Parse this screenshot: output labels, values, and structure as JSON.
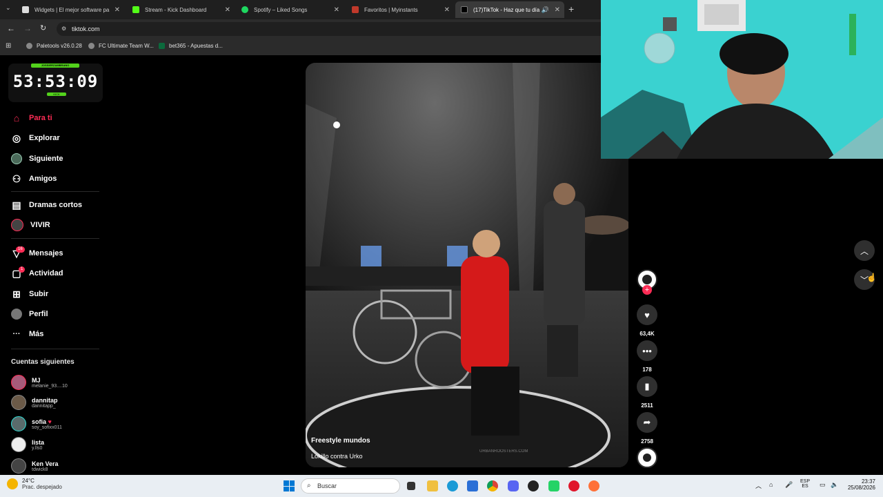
{
  "browser": {
    "tabs": [
      {
        "title": "Widgets | El mejor software pa",
        "color": "#3a3a3a"
      },
      {
        "title": "Stream - Kick Dashboard",
        "color": "#53fc18"
      },
      {
        "title": "Spotify – Liked Songs",
        "color": "#1ed760"
      },
      {
        "title": "Favoritos | Myinstants",
        "color": "#c0392b"
      },
      {
        "title": "(17)TikTok - Haz que tu día",
        "color": "#000000"
      }
    ],
    "url": "tiktok.com",
    "bookmarks": [
      {
        "label": "Paletools v26.0.28"
      },
      {
        "label": "FC Ultimate Team W..."
      },
      {
        "label": "bet365 - Apuestas d..."
      }
    ]
  },
  "timer": {
    "top": "JOSSIERZAMBRANO",
    "digits": "53:53:09",
    "bottom": "KICK"
  },
  "sidebar": {
    "nav": [
      {
        "label": "Para ti",
        "icon": "home-icon",
        "glyph": "⌂"
      },
      {
        "label": "Explorar",
        "icon": "compass-icon",
        "glyph": "◎"
      },
      {
        "label": "Siguiente",
        "icon": "following-avatar-icon",
        "glyph": "●"
      },
      {
        "label": "Amigos",
        "icon": "friends-icon",
        "glyph": "⚇"
      },
      {
        "label": "Dramas cortos",
        "icon": "film-icon",
        "glyph": "▤"
      },
      {
        "label": "VIVIR",
        "icon": "live-icon",
        "glyph": "●"
      },
      {
        "label": "Mensajes",
        "icon": "messages-icon",
        "glyph": "▽",
        "badge": "16"
      },
      {
        "label": "Actividad",
        "icon": "activity-icon",
        "glyph": "▢",
        "badge": "1"
      },
      {
        "label": "Subir",
        "icon": "upload-icon",
        "glyph": "⊞"
      },
      {
        "label": "Perfil",
        "icon": "profile-icon",
        "glyph": "●"
      },
      {
        "label": "Más",
        "icon": "more-icon",
        "glyph": "···"
      }
    ],
    "following_title": "Cuentas siguientes",
    "following": [
      {
        "name": "MJ",
        "handle": "melanie_93....10"
      },
      {
        "name": "dannitap",
        "handle": "dannitapp_"
      },
      {
        "name": "sofia",
        "handle": "soy_sofixx011"
      },
      {
        "name": "lista",
        "handle": "y.lls0"
      },
      {
        "name": "Ken Vera",
        "handle": "tdwick8"
      }
    ]
  },
  "video": {
    "title": "Freestyle mundos",
    "subtitle": "Lokillo contra Urko",
    "watermark": "URBANROOSTERS.COM"
  },
  "actions": {
    "likes": "63,4K",
    "comments": "178",
    "saves": "2511",
    "shares": "2758"
  },
  "taskbar": {
    "weather_temp": "24°C",
    "weather_desc": "Prac. despejado",
    "search_placeholder": "Buscar",
    "lang": "ESP",
    "lang2": "ES",
    "time": "23:37",
    "date": "25/08/2026"
  }
}
